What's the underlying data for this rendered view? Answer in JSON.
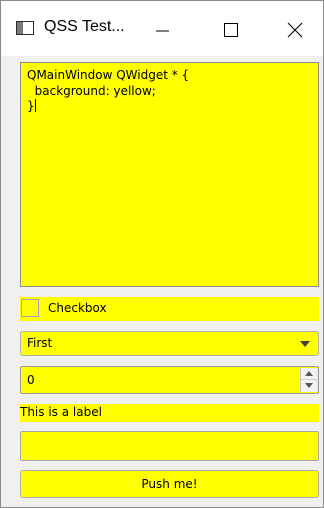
{
  "window": {
    "title": "QSS Test...",
    "app_icon": "window-app-icon",
    "controls": {
      "minimize_icon": "minimize-icon",
      "maximize_icon": "maximize-icon",
      "close_icon": "close-icon"
    }
  },
  "editor": {
    "lines": [
      "QMainWindow QWidget * {",
      "  background: yellow;",
      "}"
    ]
  },
  "checkbox": {
    "label": "Checkbox",
    "checked": false
  },
  "combo": {
    "selected": "First",
    "arrow_icon": "chevron-down-icon"
  },
  "spinbox": {
    "value": "0",
    "up_icon": "spin-up-icon",
    "down_icon": "spin-down-icon"
  },
  "label": {
    "text": "This is a label"
  },
  "line_edit": {
    "value": ""
  },
  "button": {
    "label": "Push me!"
  },
  "colors": {
    "widget_background": "#ffff00",
    "window_background": "#f0f0f0",
    "titlebar": "#ffffff"
  }
}
